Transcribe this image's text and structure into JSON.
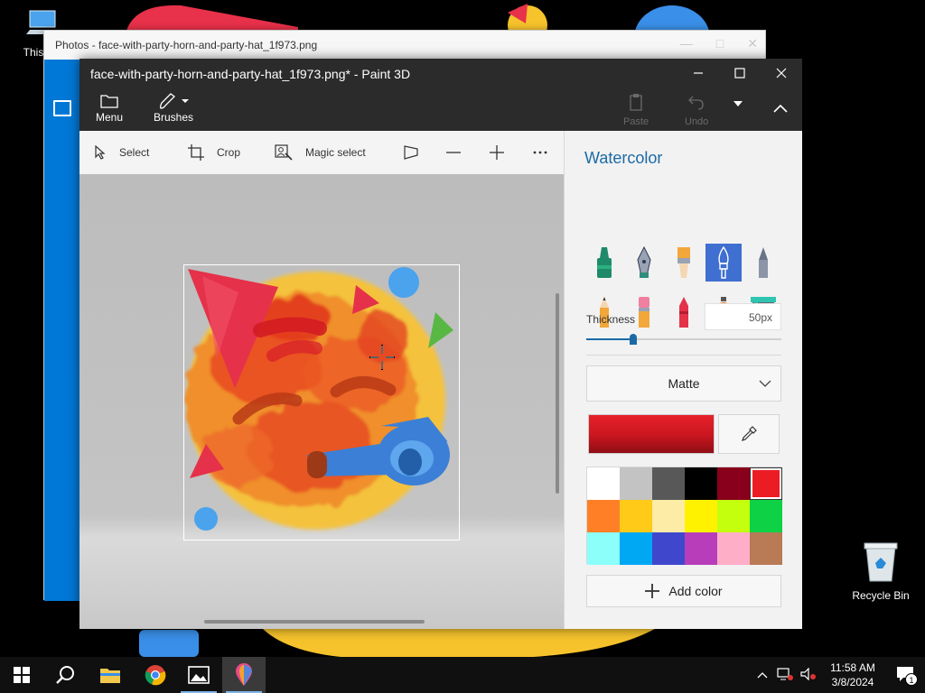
{
  "desktop": {
    "this_pc_label": "This PC",
    "recycle_bin_label": "Recycle Bin"
  },
  "photos_window": {
    "title": "Photos - face-with-party-horn-and-party-hat_1f973.png"
  },
  "paint_window": {
    "title": "face-with-party-horn-and-party-hat_1f973.png* - Paint 3D",
    "header": {
      "menu_label": "Menu",
      "brushes_label": "Brushes",
      "paste_label": "Paste",
      "undo_label": "Undo"
    },
    "toolbar": {
      "select_label": "Select",
      "crop_label": "Crop",
      "magic_select_label": "Magic select"
    },
    "panel": {
      "title": "Watercolor",
      "brushes": [
        {
          "name": "marker",
          "active": false
        },
        {
          "name": "calligraphy-pen",
          "active": false
        },
        {
          "name": "oil-brush",
          "active": false
        },
        {
          "name": "watercolor",
          "active": true
        },
        {
          "name": "pixel-pen",
          "active": false
        },
        {
          "name": "pencil",
          "active": false
        },
        {
          "name": "eraser",
          "active": false
        },
        {
          "name": "crayon",
          "active": false
        },
        {
          "name": "spray-can",
          "active": false
        },
        {
          "name": "fill",
          "active": false
        }
      ],
      "thickness_label": "Thickness",
      "thickness_value": "50px",
      "thickness_fraction": 0.24,
      "finish_value": "Matte",
      "current_color": "#e8212a",
      "palette": [
        "#ffffff",
        "#c3c3c3",
        "#585858",
        "#000000",
        "#88001b",
        "#ec1c24",
        "#ff7f27",
        "#ffca18",
        "#fdeca6",
        "#fff200",
        "#c4ff0e",
        "#0ed145",
        "#8cfffb",
        "#00a8f3",
        "#3f48cc",
        "#b83dba",
        "#ffaec8",
        "#b97a56"
      ],
      "selected_palette_index": 5,
      "add_color_label": "Add color"
    }
  },
  "taskbar": {
    "apps": [
      "start",
      "search",
      "file-explorer",
      "chrome",
      "photos",
      "paint-3d"
    ],
    "time": "11:58 AM",
    "date": "3/8/2024",
    "notification_count": "1"
  }
}
